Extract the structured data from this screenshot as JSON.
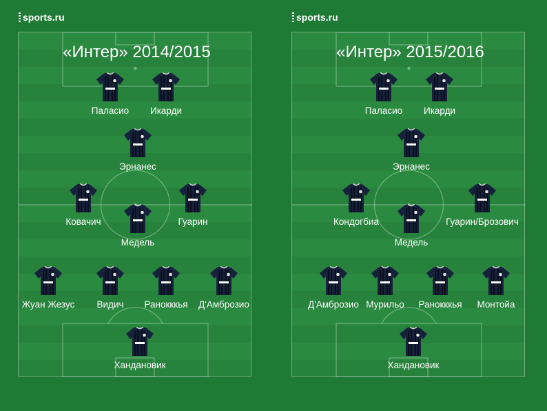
{
  "brand": "sports.ru",
  "panels": [
    {
      "title": "«Интер» 2014/2015",
      "players": {
        "forward_left": "Паласио",
        "forward_right": "Икарди",
        "attacking_mid": "Эрнанес",
        "mid_left": "Ковачич",
        "mid_center": "Медель",
        "mid_right": "Гуарин",
        "def_1": "Жуан Жезус",
        "def_2": "Видич",
        "def_3": "Ранокккья",
        "def_4": "Д'Амброзио",
        "goalkeeper": "Хандановик"
      }
    },
    {
      "title": "«Интер» 2015/2016",
      "players": {
        "forward_left": "Паласио",
        "forward_right": "Икарди",
        "attacking_mid": "Эрнанес",
        "mid_left": "Кондогбиа",
        "mid_center": "Медель",
        "mid_right": "Гуарин/Брозович",
        "def_1": "Д'Амброзио",
        "def_2": "Мурильо",
        "def_3": "Ранокккья",
        "def_4": "Монтойа",
        "goalkeeper": "Хандановик"
      }
    }
  ]
}
